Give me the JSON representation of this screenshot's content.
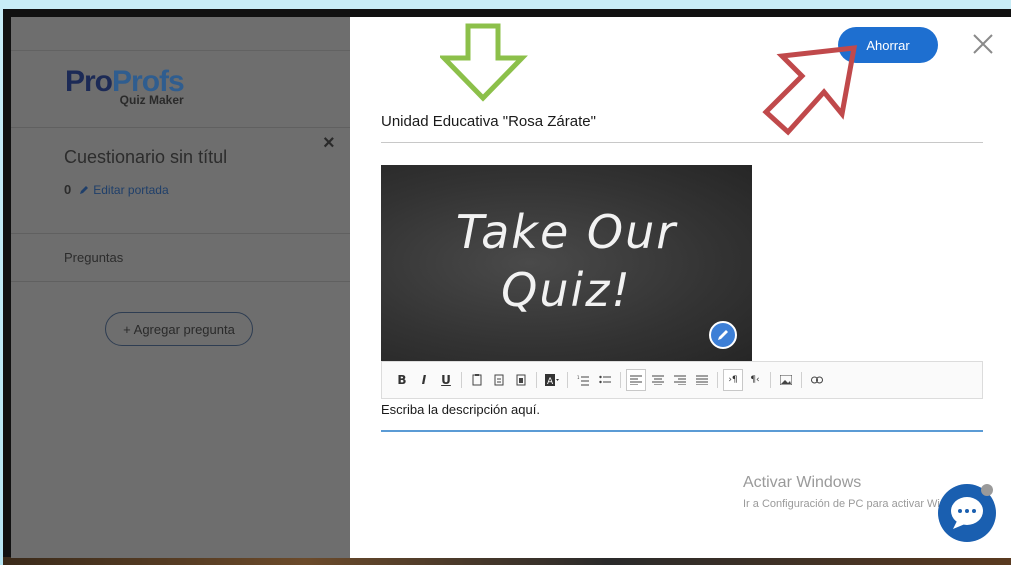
{
  "sidebar": {
    "logo": {
      "pro": "Pro",
      "profs": "Profs",
      "sub": "Quiz Maker"
    },
    "quiz_title": "Cuestionario sin títul",
    "question_count": "0",
    "edit_cover_label": "Editar portada",
    "questions_label": "Preguntas",
    "add_question_label": "+ Agregar pregunta",
    "close_glyph": "×"
  },
  "modal": {
    "save_label": "Ahorrar",
    "school_name": "Unidad Educativa \"Rosa Zárate\"",
    "cover_image_text": "Take Our\nQuiz!",
    "description_value": "Escriba la descripción aquí.",
    "toolbar": [
      "B",
      "I",
      "U"
    ]
  },
  "overlay": {
    "activate_title": "Activar Windows",
    "activate_subtitle": "Ir a Configuración de PC para activar Windows."
  },
  "colors": {
    "save_button": "#1e6fd0",
    "green_arrow": "#8cc04a",
    "red_arrow": "#c0494b",
    "chat_bubble": "#1a5fb0"
  },
  "icons": {
    "close": "close-icon",
    "pencil": "pencil-icon",
    "chat": "chat-icon",
    "arrow_down": "arrow-down-annotation",
    "arrow_pointer": "arrow-pointer-annotation"
  }
}
